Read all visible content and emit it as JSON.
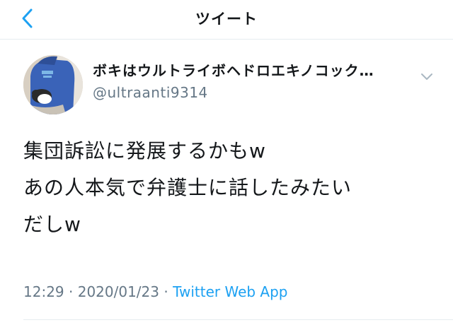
{
  "header": {
    "title": "ツイート",
    "back_icon": "chevron-left-icon",
    "accent_color": "#1da1f2"
  },
  "author": {
    "display_name": "ボキはウルトライボヘドロエキノコック…",
    "username": "@ultraanti9314",
    "menu_icon": "chevron-down-icon"
  },
  "tweet": {
    "lines": [
      "集団訴訟に発展するかもw",
      "あの人本気で弁護士に話したみたい",
      "だしw"
    ],
    "time": "12:29",
    "separator1": " · ",
    "date": "2020/01/23",
    "separator2": " · ",
    "source": "Twitter Web App"
  }
}
